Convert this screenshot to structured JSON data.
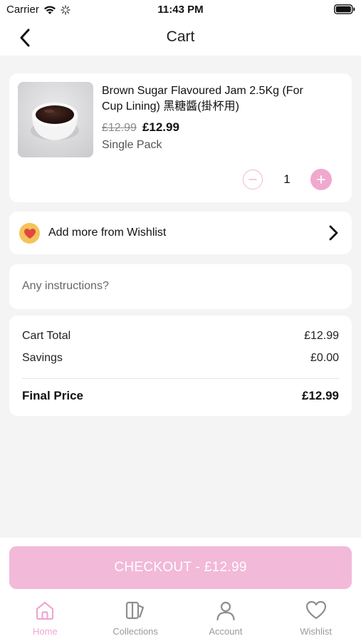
{
  "status_bar": {
    "carrier": "Carrier",
    "time": "11:43 PM"
  },
  "nav": {
    "title": "Cart"
  },
  "cart_item": {
    "name": "Brown Sugar Flavoured Jam 2.5Kg (For Cup Lining) 黑糖醬(掛杯用)",
    "original_price": "£12.99",
    "price": "£12.99",
    "variant": "Single Pack",
    "quantity": "1"
  },
  "wishlist": {
    "label": "Add more from Wishlist"
  },
  "instructions": {
    "placeholder": "Any instructions?",
    "value": ""
  },
  "summary": {
    "cart_total_label": "Cart Total",
    "cart_total_value": "£12.99",
    "savings_label": "Savings",
    "savings_value": "£0.00",
    "final_label": "Final Price",
    "final_value": "£12.99"
  },
  "checkout": {
    "label": "CHECKOUT - £12.99"
  },
  "tabs": [
    {
      "label": "Home",
      "icon": "home-icon",
      "active": true
    },
    {
      "label": "Collections",
      "icon": "collections-icon",
      "active": false
    },
    {
      "label": "Account",
      "icon": "account-icon",
      "active": false
    },
    {
      "label": "Wishlist",
      "icon": "heart-icon",
      "active": false
    }
  ],
  "colors": {
    "accent": "#f1a6cf",
    "checkout_bg": "#f2b9d9",
    "background": "#f4f4f4"
  }
}
